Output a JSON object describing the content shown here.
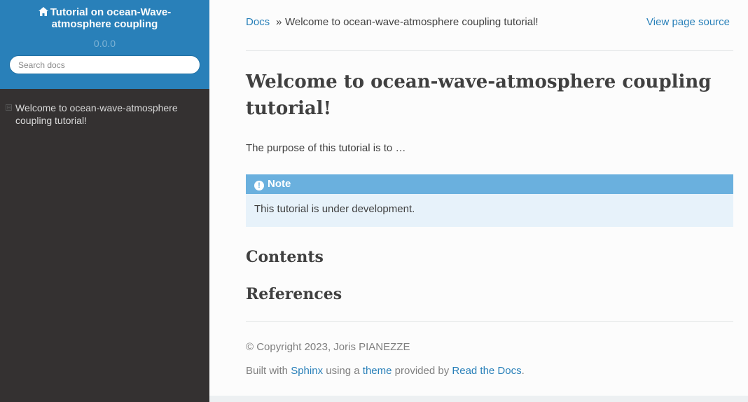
{
  "sidebar": {
    "project_title": "Tutorial on ocean-Wave-atmosphere coupling",
    "home_icon": "home-icon",
    "version": "0.0.0",
    "search_placeholder": "Search docs",
    "toc_items": [
      {
        "label": "Welcome to ocean-wave-atmosphere coupling tutorial!",
        "toggle": "⊟"
      }
    ]
  },
  "breadcrumbs": {
    "home": "Docs",
    "separator": "»",
    "current": "Welcome to ocean-wave-atmosphere coupling tutorial!",
    "view_source": "View page source"
  },
  "main": {
    "title": "Welcome to ocean-wave-atmosphere coupling tutorial!",
    "intro": "The purpose of this tutorial is to …",
    "note": {
      "icon": "exclamation-circle-icon",
      "icon_glyph": "!",
      "title": "Note",
      "body": "This tutorial is under development."
    },
    "sections": [
      "Contents",
      "References"
    ]
  },
  "footer": {
    "copyright": "© Copyright 2023, Joris PIANEZZE",
    "built_prefix": "Built with ",
    "sphinx_link": "Sphinx",
    "using_a": " using a ",
    "theme_link": "theme",
    "provided_by": " provided by ",
    "rtd_link": "Read the Docs",
    "period": "."
  },
  "colors": {
    "sidebar_bg": "#343131",
    "header_bg": "#2980b9",
    "link": "#2980b9",
    "note_title_bg": "#6ab0de",
    "note_body_bg": "#e7f2fa",
    "content_bg": "#fcfcfc"
  }
}
